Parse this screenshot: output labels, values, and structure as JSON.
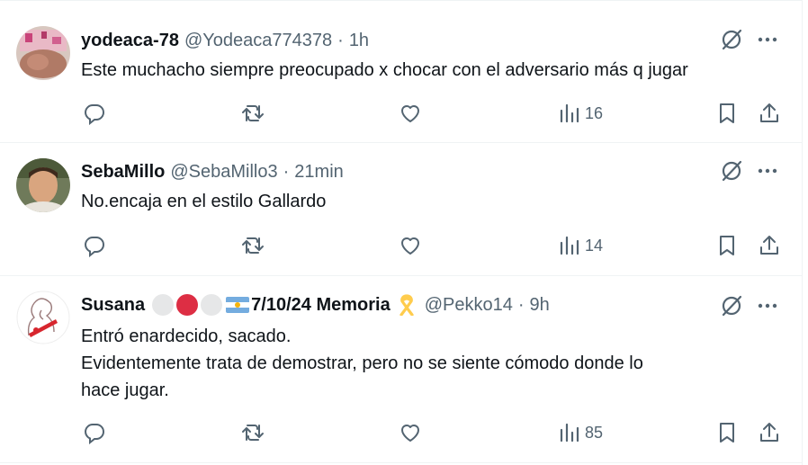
{
  "replies": [
    {
      "name": "yodeaca-78",
      "handle": "@Yodeaca774378",
      "separator": "·",
      "time": "1h",
      "text_lines": [
        "Este muchacho siempre preocupado x chocar con el adversario más q jugar"
      ],
      "views": "16"
    },
    {
      "name": "SebaMillo",
      "handle": "@SebaMillo3",
      "separator": "·",
      "time": "21min",
      "text_lines": [
        "No.encaja en el estilo Gallardo"
      ],
      "views": "14"
    },
    {
      "name_prefix": "Susana",
      "name_suffix": "7/10/24 Memoria",
      "handle": "@Pekko14",
      "separator": "·",
      "time": "9h",
      "text_lines": [
        "Entró enardecido, sacado.",
        "Evidentemente trata de demostrar, pero no se siente cómodo donde lo",
        "hace jugar."
      ],
      "views": "85"
    }
  ],
  "icons": {
    "reply": "reply-icon",
    "retweet": "retweet-icon",
    "like": "like-icon",
    "views": "views-icon",
    "bookmark": "bookmark-icon",
    "share": "share-icon",
    "grok": "grok-icon",
    "more": "more-icon"
  },
  "colors": {
    "text": "#0f1419",
    "secondary": "#536471",
    "border": "#eff3f4",
    "emoji_white": "#e6e7e8",
    "emoji_red": "#dd2e44",
    "ribbon": "#ffcc4d"
  }
}
